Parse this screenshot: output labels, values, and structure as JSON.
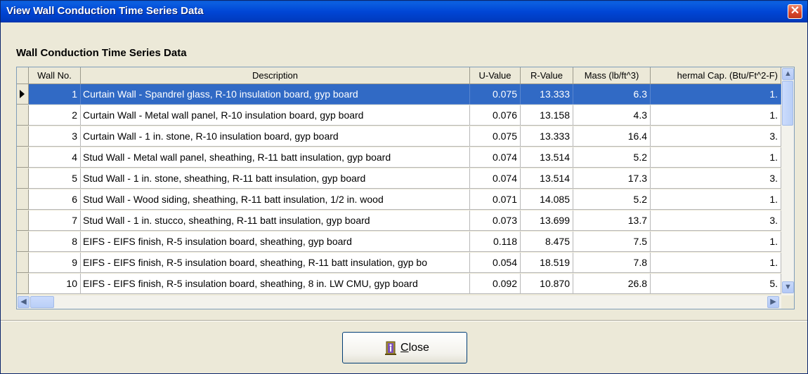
{
  "window": {
    "title": "View Wall Conduction Time Series Data",
    "close_glyph": "✕"
  },
  "group_label": "Wall Conduction Time Series Data",
  "table": {
    "columns": [
      "Wall No.",
      "Description",
      "U-Value",
      "R-Value",
      "Mass (lb/ft^3)",
      "hermal Cap. (Btu/Ft^2-F)"
    ],
    "selected_row": 0,
    "rows": [
      {
        "no": "1",
        "desc": "Curtain Wall - Spandrel glass, R-10 insulation board, gyp board",
        "u": "0.075",
        "r": "13.333",
        "mass": "6.3",
        "cap": "1."
      },
      {
        "no": "2",
        "desc": "Curtain Wall - Metal wall panel, R-10 insulation board, gyp board",
        "u": "0.076",
        "r": "13.158",
        "mass": "4.3",
        "cap": "1."
      },
      {
        "no": "3",
        "desc": "Curtain Wall - 1 in. stone, R-10 insulation board, gyp board",
        "u": "0.075",
        "r": "13.333",
        "mass": "16.4",
        "cap": "3."
      },
      {
        "no": "4",
        "desc": "Stud Wall - Metal wall panel, sheathing, R-11 batt insulation, gyp board",
        "u": "0.074",
        "r": "13.514",
        "mass": "5.2",
        "cap": "1."
      },
      {
        "no": "5",
        "desc": "Stud Wall - 1 in. stone, sheathing, R-11 batt insulation, gyp board",
        "u": "0.074",
        "r": "13.514",
        "mass": "17.3",
        "cap": "3."
      },
      {
        "no": "6",
        "desc": "Stud Wall - Wood siding, sheathing, R-11 batt insulation, 1/2 in. wood",
        "u": "0.071",
        "r": "14.085",
        "mass": "5.2",
        "cap": "1."
      },
      {
        "no": "7",
        "desc": "Stud Wall - 1 in. stucco, sheathing, R-11 batt insulation, gyp board",
        "u": "0.073",
        "r": "13.699",
        "mass": "13.7",
        "cap": "3."
      },
      {
        "no": "8",
        "desc": "EIFS - EIFS finish, R-5 insulation board, sheathing, gyp board",
        "u": "0.118",
        "r": "8.475",
        "mass": "7.5",
        "cap": "1."
      },
      {
        "no": "9",
        "desc": "EIFS - EIFS finish, R-5 insulation board, sheathing, R-11 batt insulation, gyp bo",
        "u": "0.054",
        "r": "18.519",
        "mass": "7.8",
        "cap": "1."
      },
      {
        "no": "10",
        "desc": "EIFS - EIFS finish, R-5 insulation board, sheathing, 8 in. LW CMU, gyp board",
        "u": "0.092",
        "r": "10.870",
        "mass": "26.8",
        "cap": "5."
      }
    ]
  },
  "scrollbars": {
    "up_glyph": "▲",
    "down_glyph": "▼",
    "left_glyph": "◀",
    "right_glyph": "▶"
  },
  "footer": {
    "close_label": "Close",
    "close_mnemonic_index": 0,
    "close_icon": "door-exit-icon"
  },
  "colors": {
    "title_bar": "#0046d5",
    "selection": "#316ac5",
    "face": "#ece9d8"
  }
}
